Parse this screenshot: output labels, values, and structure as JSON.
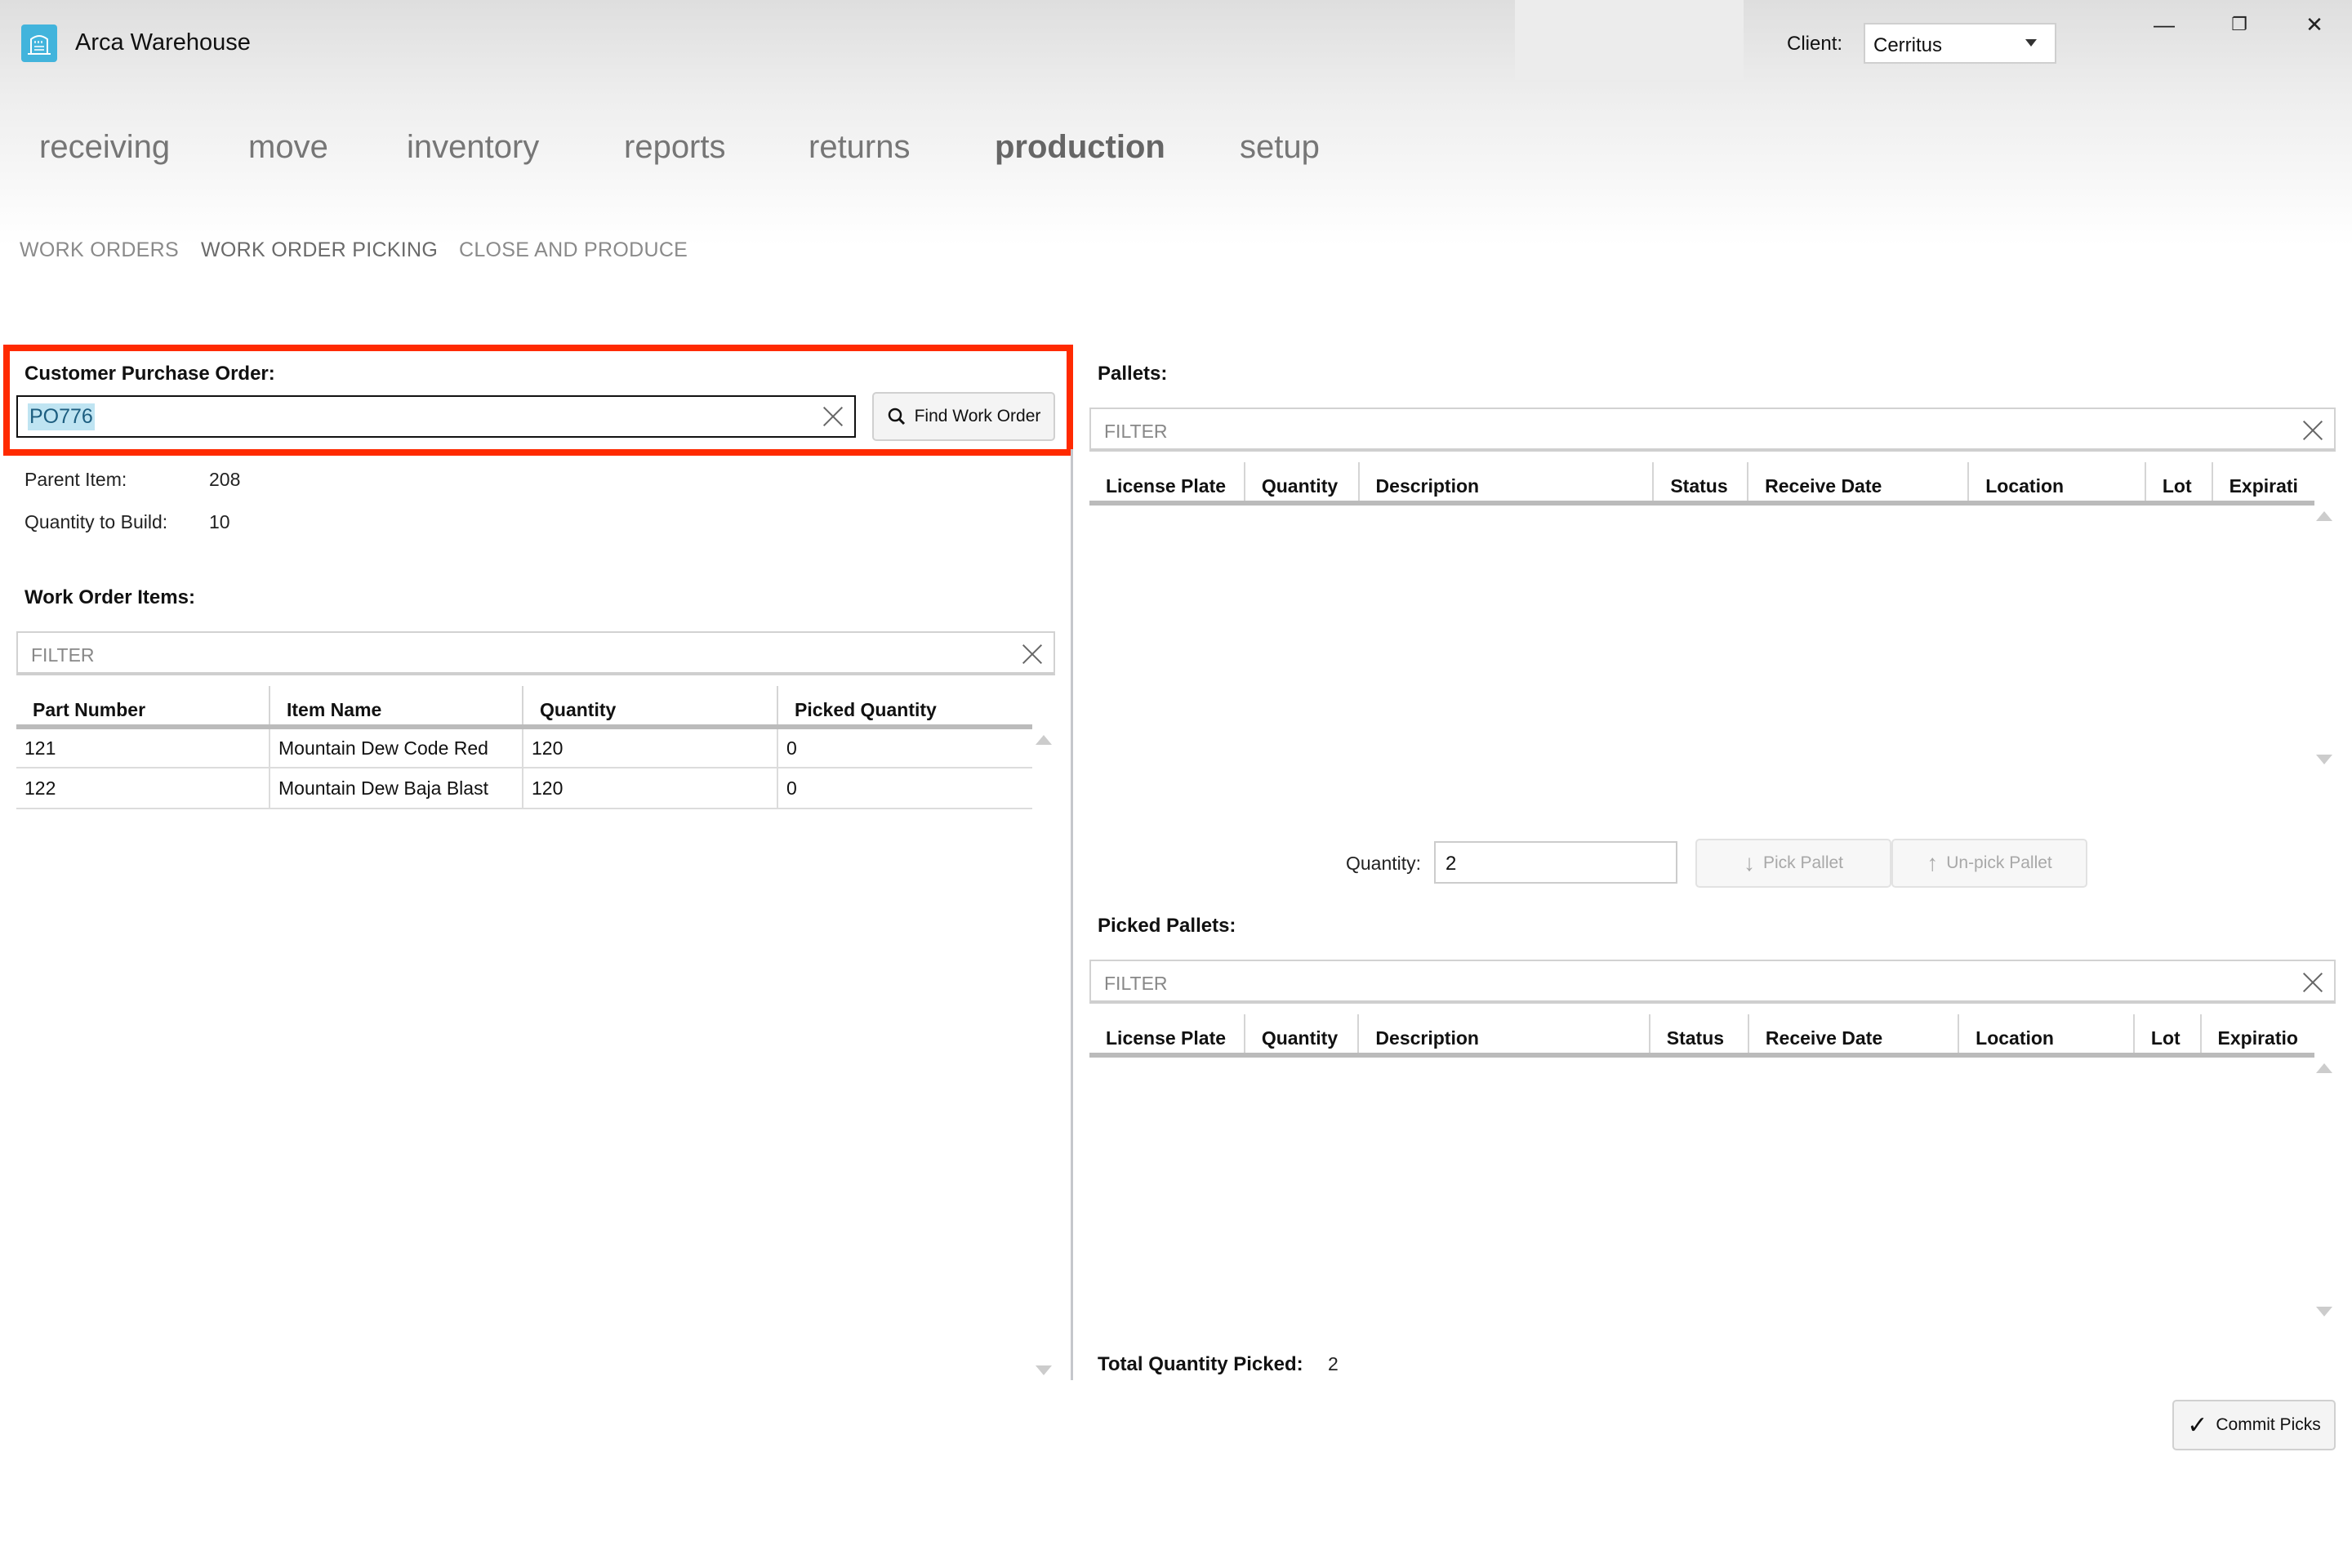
{
  "app": {
    "title": "Arca Warehouse",
    "client_label": "Client:",
    "client_value": "Cerritus",
    "window_controls": [
      "minimize",
      "restore",
      "close"
    ]
  },
  "nav": {
    "items": [
      {
        "label": "receiving",
        "active": false
      },
      {
        "label": "move",
        "active": false
      },
      {
        "label": "inventory",
        "active": false
      },
      {
        "label": "reports",
        "active": false
      },
      {
        "label": "returns",
        "active": false
      },
      {
        "label": "production",
        "active": true
      },
      {
        "label": "setup",
        "active": false
      }
    ],
    "subitems": [
      {
        "label": "WORK ORDERS",
        "active": false
      },
      {
        "label": "WORK ORDER PICKING",
        "active": true
      },
      {
        "label": "CLOSE AND PRODUCE",
        "active": false
      }
    ]
  },
  "left": {
    "po_label": "Customer Purchase Order:",
    "po_value": "PO776",
    "find_button": "Find Work Order",
    "parent_item_label": "Parent Item:",
    "parent_item_value": "208",
    "qty_build_label": "Quantity to Build:",
    "qty_build_value": "10",
    "items_label": "Work Order Items:",
    "filter_placeholder": "FILTER",
    "columns": [
      "Part Number",
      "Item Name",
      "Quantity",
      "Picked Quantity"
    ],
    "rows": [
      [
        "121",
        "Mountain Dew Code Red",
        "120",
        "0"
      ],
      [
        "122",
        "Mountain Dew Baja Blast",
        "120",
        "0"
      ]
    ]
  },
  "right": {
    "pallets_label": "Pallets:",
    "filter_placeholder": "FILTER",
    "columns": [
      "License Plate",
      "Quantity",
      "Description",
      "Status",
      "Receive Date",
      "Location",
      "Lot",
      "Expirati"
    ],
    "quantity_label": "Quantity:",
    "quantity_value": "2",
    "pick_button": "Pick Pallet",
    "unpick_button": "Un-pick Pallet",
    "picked_label": "Picked Pallets:",
    "picked_filter_placeholder": "FILTER",
    "picked_columns": [
      "License Plate",
      "Quantity",
      "Description",
      "Status",
      "Receive Date",
      "Location",
      "Lot",
      "Expiratio"
    ],
    "total_label": "Total Quantity Picked:",
    "total_value": "2",
    "commit_button": "Commit Picks"
  },
  "colors": {
    "accent": "#42b4dc",
    "highlight": "#ff2a00",
    "selection": "#bfe4f2"
  }
}
